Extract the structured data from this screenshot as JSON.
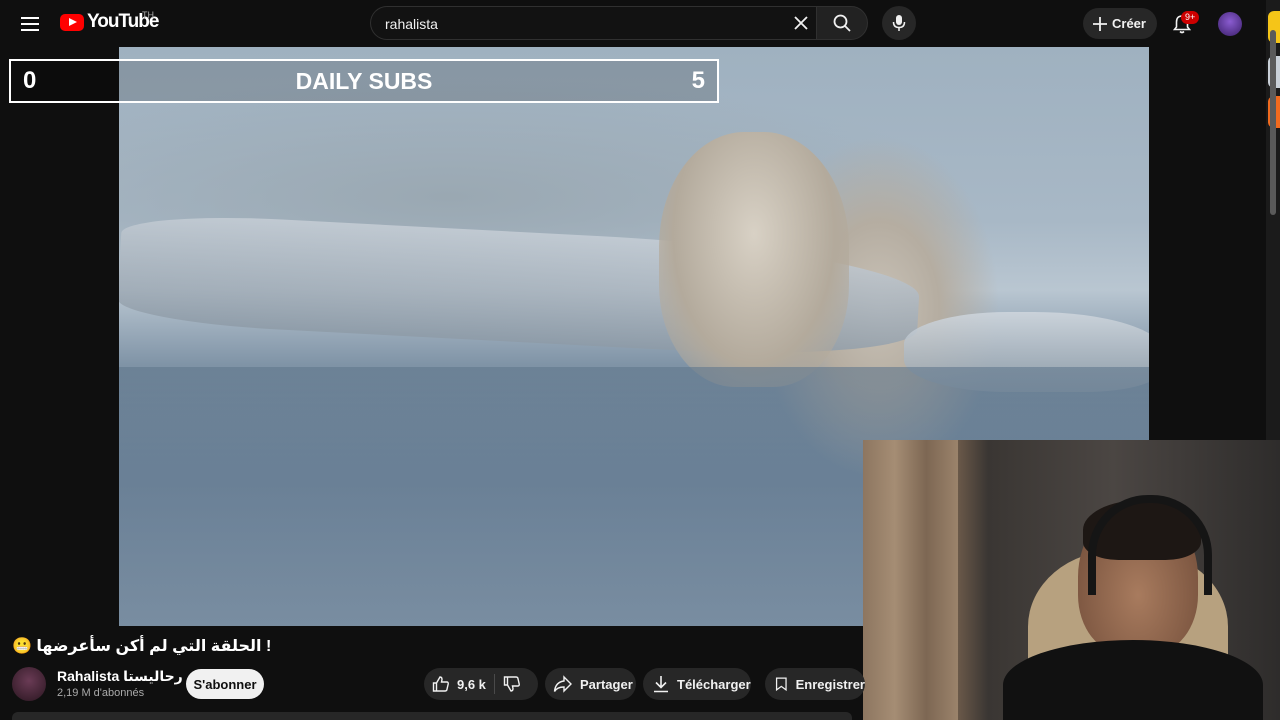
{
  "header": {
    "logo_text": "YouTube",
    "country_code": "TH",
    "search": {
      "value": "rahalista"
    },
    "create_label": "Créer",
    "notifications_badge": "9+"
  },
  "video": {
    "overlay": {
      "left_value": "0",
      "title": "DAILY SUBS",
      "right_value": "5"
    }
  },
  "details": {
    "title": "😬 الحلقة التي لم أكن سأعرضها !",
    "channel_name": "Rahalista رحاليستا",
    "subscribers": "2,19 M d'abonnés",
    "subscribe_label": "S'abonner",
    "likes": "9,6 k",
    "share_label": "Partager",
    "download_label": "Télécharger",
    "save_label": "Enregistrer"
  },
  "colors": {
    "background": "#0f0f0f",
    "brand_red": "#ff0000",
    "pill": "#272727"
  }
}
